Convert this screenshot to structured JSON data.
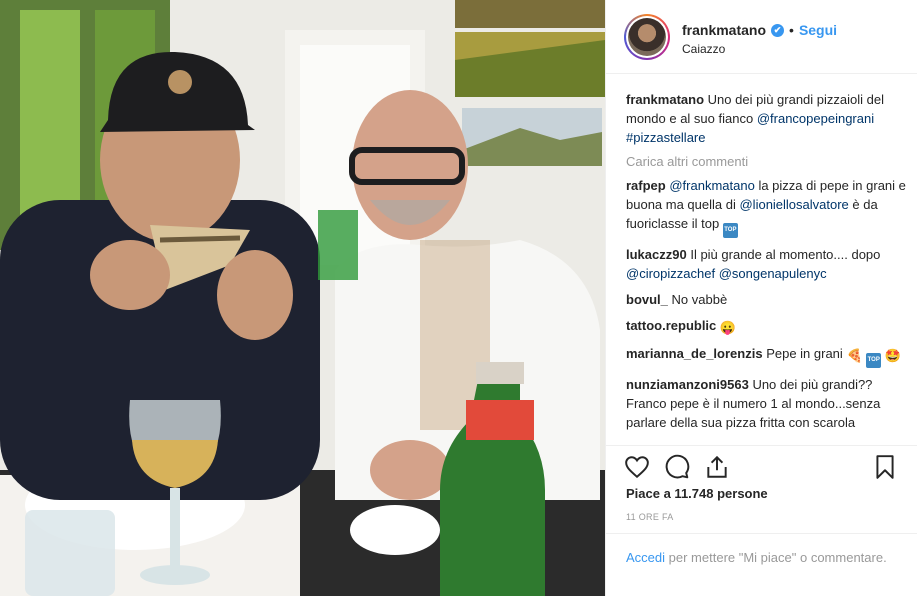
{
  "post": {
    "username": "frankmatano",
    "verified_badge": "✔",
    "follow_label": "Segui",
    "location": "Caiazzo"
  },
  "caption": {
    "user": "frankmatano",
    "text": "Uno dei più grandi pizzaioli del mondo e al suo fianco",
    "mention": "@francopepeingrani",
    "hashtag": "#pizzastellare"
  },
  "load_more_label": "Carica altri commenti",
  "comments": [
    {
      "user": "rafpep",
      "mention1": "@frankmatano",
      "text1": "la pizza di pepe in grani e buona ma quella di",
      "mention2": "@lioniellosalvatore",
      "text2": "è da fuoriclasse il top",
      "badge": "TOP"
    },
    {
      "user": "lukaczz90",
      "text1": "Il più grande al momento.... dopo",
      "mention1": "@ciropizzachef",
      "mention2": "@songenapulenyc"
    },
    {
      "user": "bovul_",
      "text1": "No vabbè"
    },
    {
      "user": "tattoo.republic",
      "emoji": "😛"
    },
    {
      "user": "marianna_de_lorenzis",
      "text1": "Pepe in grani",
      "emoji1": "🍕",
      "badge": "TOP",
      "emoji2": "🤩"
    },
    {
      "user": "nunziamanzoni9563",
      "text1": "Uno dei più grandi?? Franco pepe è il numero 1 al mondo...senza parlare della sua pizza fritta con scarola"
    }
  ],
  "icons": {
    "like": "heart-icon",
    "comment": "comment-icon",
    "share": "share-icon",
    "save": "bookmark-icon"
  },
  "likes_text": "Piace a 11.748 persone",
  "timestamp": "11 ORE FA",
  "login_prompt": {
    "link": "Accedi",
    "text": "per mettere \"Mi piace\" o commentare."
  },
  "colors": {
    "link_blue": "#3897f0",
    "mention_blue": "#003569",
    "muted": "#999999",
    "text": "#262626"
  }
}
